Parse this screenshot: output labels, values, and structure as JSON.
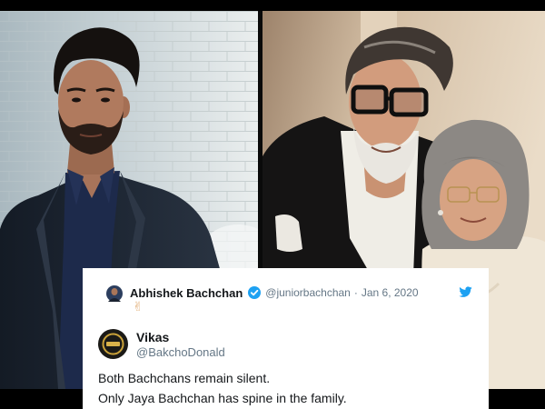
{
  "colors": {
    "accent": "#1da1f2",
    "text_primary": "#14171a",
    "text_secondary": "#657786",
    "card_background": "#ffffff",
    "frame": "#000000",
    "emoji": "#e3b27e"
  },
  "icons": {
    "verified": "verified-badge-icon",
    "platform": "twitter-bird-icon",
    "emoji": "victory-hand-emoji"
  },
  "tweet": {
    "author": {
      "name": "Abhishek Bachchan",
      "verified": true,
      "handle": "@juniorbachchan",
      "separator": "·",
      "date": "Jan 6, 2020"
    },
    "body": "✌",
    "reply_to": {
      "name": "Vikas",
      "handle": "@BakchoDonald",
      "text_lines": [
        "Both Bachchans remain silent.",
        "Only Jaya Bachchan has spine in the family."
      ]
    }
  }
}
